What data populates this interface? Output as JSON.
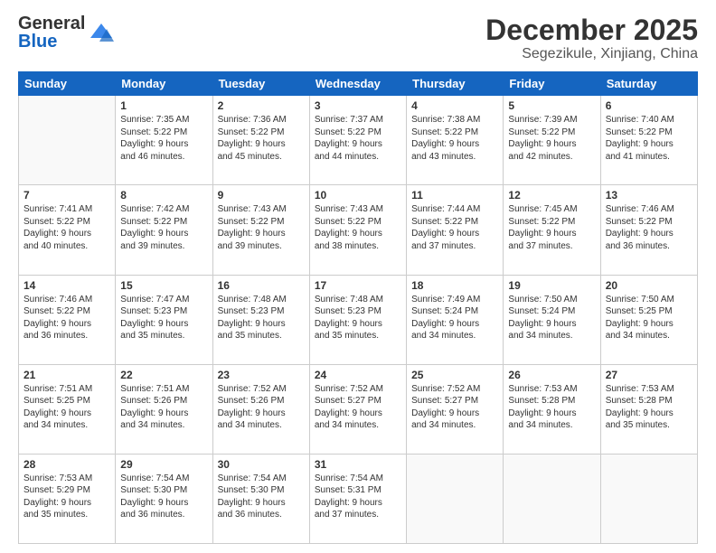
{
  "header": {
    "logo_line1": "General",
    "logo_line2": "Blue",
    "month": "December 2025",
    "location": "Segezikule, Xinjiang, China"
  },
  "days_of_week": [
    "Sunday",
    "Monday",
    "Tuesday",
    "Wednesday",
    "Thursday",
    "Friday",
    "Saturday"
  ],
  "weeks": [
    [
      {
        "day": "",
        "info": ""
      },
      {
        "day": "1",
        "info": "Sunrise: 7:35 AM\nSunset: 5:22 PM\nDaylight: 9 hours\nand 46 minutes."
      },
      {
        "day": "2",
        "info": "Sunrise: 7:36 AM\nSunset: 5:22 PM\nDaylight: 9 hours\nand 45 minutes."
      },
      {
        "day": "3",
        "info": "Sunrise: 7:37 AM\nSunset: 5:22 PM\nDaylight: 9 hours\nand 44 minutes."
      },
      {
        "day": "4",
        "info": "Sunrise: 7:38 AM\nSunset: 5:22 PM\nDaylight: 9 hours\nand 43 minutes."
      },
      {
        "day": "5",
        "info": "Sunrise: 7:39 AM\nSunset: 5:22 PM\nDaylight: 9 hours\nand 42 minutes."
      },
      {
        "day": "6",
        "info": "Sunrise: 7:40 AM\nSunset: 5:22 PM\nDaylight: 9 hours\nand 41 minutes."
      }
    ],
    [
      {
        "day": "7",
        "info": "Sunrise: 7:41 AM\nSunset: 5:22 PM\nDaylight: 9 hours\nand 40 minutes."
      },
      {
        "day": "8",
        "info": "Sunrise: 7:42 AM\nSunset: 5:22 PM\nDaylight: 9 hours\nand 39 minutes."
      },
      {
        "day": "9",
        "info": "Sunrise: 7:43 AM\nSunset: 5:22 PM\nDaylight: 9 hours\nand 39 minutes."
      },
      {
        "day": "10",
        "info": "Sunrise: 7:43 AM\nSunset: 5:22 PM\nDaylight: 9 hours\nand 38 minutes."
      },
      {
        "day": "11",
        "info": "Sunrise: 7:44 AM\nSunset: 5:22 PM\nDaylight: 9 hours\nand 37 minutes."
      },
      {
        "day": "12",
        "info": "Sunrise: 7:45 AM\nSunset: 5:22 PM\nDaylight: 9 hours\nand 37 minutes."
      },
      {
        "day": "13",
        "info": "Sunrise: 7:46 AM\nSunset: 5:22 PM\nDaylight: 9 hours\nand 36 minutes."
      }
    ],
    [
      {
        "day": "14",
        "info": "Sunrise: 7:46 AM\nSunset: 5:22 PM\nDaylight: 9 hours\nand 36 minutes."
      },
      {
        "day": "15",
        "info": "Sunrise: 7:47 AM\nSunset: 5:23 PM\nDaylight: 9 hours\nand 35 minutes."
      },
      {
        "day": "16",
        "info": "Sunrise: 7:48 AM\nSunset: 5:23 PM\nDaylight: 9 hours\nand 35 minutes."
      },
      {
        "day": "17",
        "info": "Sunrise: 7:48 AM\nSunset: 5:23 PM\nDaylight: 9 hours\nand 35 minutes."
      },
      {
        "day": "18",
        "info": "Sunrise: 7:49 AM\nSunset: 5:24 PM\nDaylight: 9 hours\nand 34 minutes."
      },
      {
        "day": "19",
        "info": "Sunrise: 7:50 AM\nSunset: 5:24 PM\nDaylight: 9 hours\nand 34 minutes."
      },
      {
        "day": "20",
        "info": "Sunrise: 7:50 AM\nSunset: 5:25 PM\nDaylight: 9 hours\nand 34 minutes."
      }
    ],
    [
      {
        "day": "21",
        "info": "Sunrise: 7:51 AM\nSunset: 5:25 PM\nDaylight: 9 hours\nand 34 minutes."
      },
      {
        "day": "22",
        "info": "Sunrise: 7:51 AM\nSunset: 5:26 PM\nDaylight: 9 hours\nand 34 minutes."
      },
      {
        "day": "23",
        "info": "Sunrise: 7:52 AM\nSunset: 5:26 PM\nDaylight: 9 hours\nand 34 minutes."
      },
      {
        "day": "24",
        "info": "Sunrise: 7:52 AM\nSunset: 5:27 PM\nDaylight: 9 hours\nand 34 minutes."
      },
      {
        "day": "25",
        "info": "Sunrise: 7:52 AM\nSunset: 5:27 PM\nDaylight: 9 hours\nand 34 minutes."
      },
      {
        "day": "26",
        "info": "Sunrise: 7:53 AM\nSunset: 5:28 PM\nDaylight: 9 hours\nand 34 minutes."
      },
      {
        "day": "27",
        "info": "Sunrise: 7:53 AM\nSunset: 5:28 PM\nDaylight: 9 hours\nand 35 minutes."
      }
    ],
    [
      {
        "day": "28",
        "info": "Sunrise: 7:53 AM\nSunset: 5:29 PM\nDaylight: 9 hours\nand 35 minutes."
      },
      {
        "day": "29",
        "info": "Sunrise: 7:54 AM\nSunset: 5:30 PM\nDaylight: 9 hours\nand 36 minutes."
      },
      {
        "day": "30",
        "info": "Sunrise: 7:54 AM\nSunset: 5:30 PM\nDaylight: 9 hours\nand 36 minutes."
      },
      {
        "day": "31",
        "info": "Sunrise: 7:54 AM\nSunset: 5:31 PM\nDaylight: 9 hours\nand 37 minutes."
      },
      {
        "day": "",
        "info": ""
      },
      {
        "day": "",
        "info": ""
      },
      {
        "day": "",
        "info": ""
      }
    ]
  ]
}
